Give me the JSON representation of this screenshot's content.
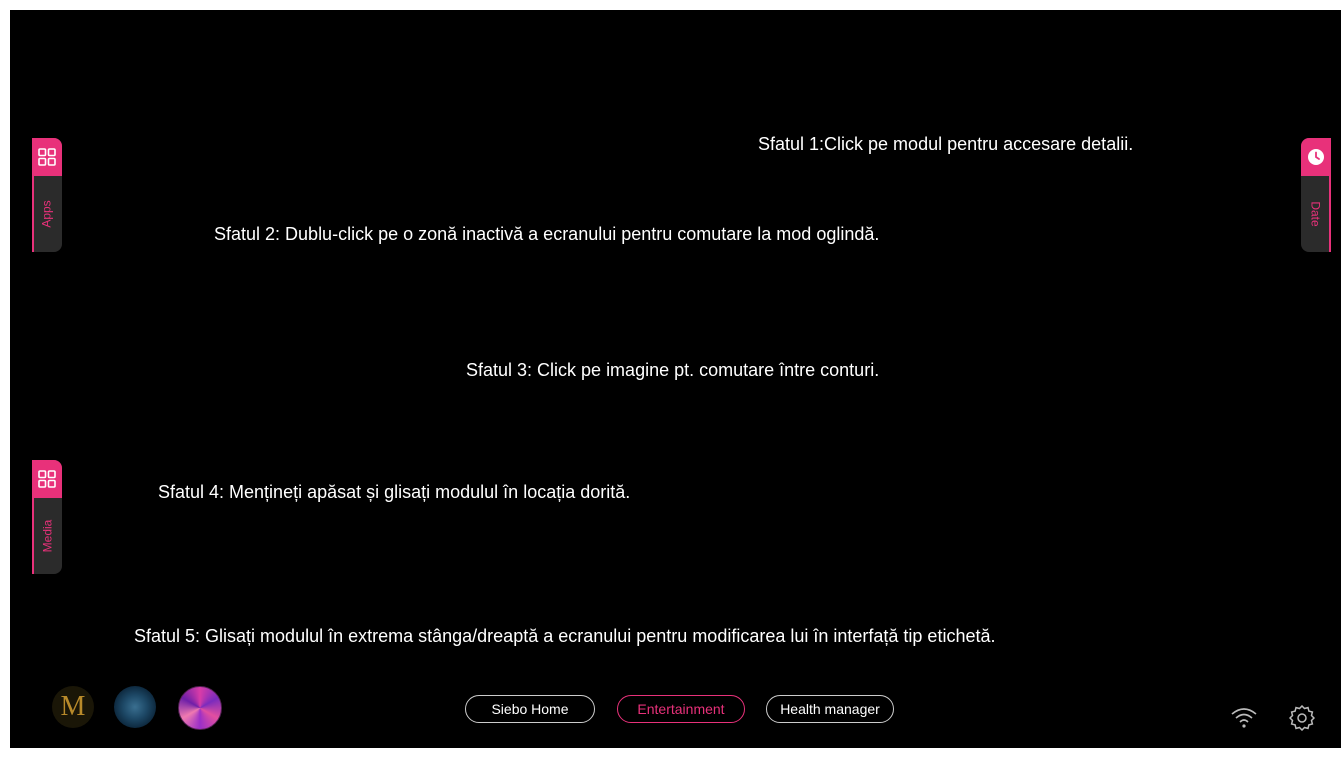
{
  "tips": [
    "Sfatul 1:Click pe modul pentru accesare detalii.",
    "Sfatul 2: Dublu-click pe o zonă inactivă a ecranului pentru comutare la mod oglindă.",
    "Sfatul 3: Click pe imagine pt. comutare între conturi.",
    "Sfatul 4: Mențineți apăsat și glisați modulul în locația dorită.",
    "Sfatul 5: Glisați modulul în extrema stânga/dreaptă a ecranului pentru modificarea lui în interfață tip etichetă."
  ],
  "side_tabs": {
    "apps": {
      "label": "Apps",
      "icon": "grid-icon"
    },
    "media": {
      "label": "Media",
      "icon": "grid-icon"
    },
    "date": {
      "label": "Date",
      "icon": "clock-icon"
    }
  },
  "bottom_bar": {
    "avatars": [
      {
        "letter": "M",
        "icon": "account-m-avatar"
      },
      {
        "icon": "globe-avatar"
      },
      {
        "icon": "flower-avatar"
      }
    ],
    "nav": [
      "Siebo Home",
      "Entertainment",
      "Health manager"
    ],
    "active_nav": "Entertainment",
    "status_icons": [
      "wifi-icon",
      "gear-icon"
    ]
  },
  "colors": {
    "accent": "#e8317a",
    "background": "#000000",
    "text": "#ffffff"
  }
}
